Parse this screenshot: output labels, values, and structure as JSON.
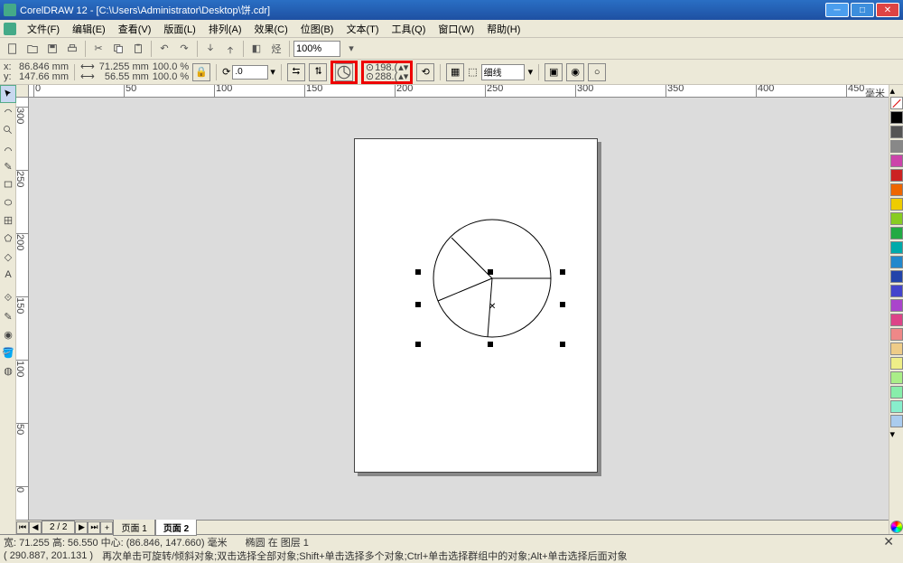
{
  "title": "CorelDRAW 12 - [C:\\Users\\Administrator\\Desktop\\饼.cdr]",
  "menu": [
    "文件(F)",
    "编辑(E)",
    "查看(V)",
    "版面(L)",
    "排列(A)",
    "效果(C)",
    "位图(B)",
    "文本(T)",
    "工具(Q)",
    "窗口(W)",
    "帮助(H)"
  ],
  "zoom": "100%",
  "coords": {
    "x_lbl": "x:",
    "x": "86.846 mm",
    "y_lbl": "y:",
    "y": "147.66 mm"
  },
  "size": {
    "w": "71.255 mm",
    "h": "56.55 mm"
  },
  "scale": {
    "x": "100.0",
    "y": "100.0",
    "pct": "%"
  },
  "rotation": ".0",
  "hl_spin": {
    "a": "198.(",
    "b": "288.("
  },
  "outline": "细线",
  "pages": {
    "current": "2 / 2",
    "tab1": "页面 1",
    "tab2": "页面 2"
  },
  "status1": {
    "dim": "宽: 71.255 高: 56.550 中心: (86.846, 147.660) 毫米",
    "obj": "椭圆 在 图层 1"
  },
  "status2": {
    "coord": "( 290.887, 201.131 )",
    "hint": "再次单击可旋转/倾斜对象;双击选择全部对象;Shift+单击选择多个对象;Ctrl+单击选择群组中的对象;Alt+单击选择后面对象"
  },
  "ruler_h": [
    "0",
    "50",
    "100",
    "150",
    "200",
    "250",
    "300",
    "350",
    "400",
    "450",
    "毫米"
  ],
  "ruler_v": [
    "300",
    "250",
    "200",
    "150",
    "100",
    "50",
    "0"
  ],
  "colors": [
    "#000",
    "#666",
    "#888",
    "#d4a",
    "#c22",
    "#e60",
    "#ec0",
    "#8c2",
    "#2a4",
    "#0aa",
    "#28c",
    "#24a",
    "#44c",
    "#a4c",
    "#c4a",
    "#d48",
    "#e88",
    "#ec8",
    "#ee8",
    "#ae8",
    "#8ea",
    "#8ec",
    "#ace"
  ]
}
